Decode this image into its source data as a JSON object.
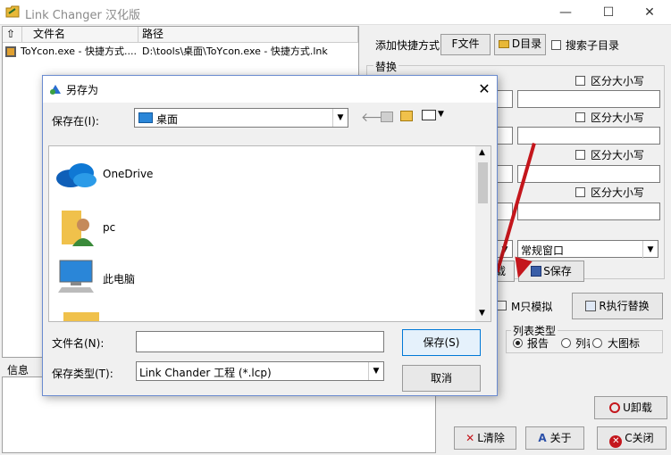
{
  "window": {
    "title": "Link Changer 汉化版",
    "min": "—",
    "max": "☐",
    "close": "✕"
  },
  "list": {
    "headers": [
      "⇧",
      "文件名",
      "路径"
    ],
    "rows": [
      {
        "name": "ToYcon.exe - 快捷方式....",
        "path": "D:\\tools\\桌面\\ToYcon.exe - 快捷方式.lnk"
      }
    ]
  },
  "right": {
    "add_label": "添加快捷方式",
    "file_btn": "F文件",
    "dir_btn": "D目录",
    "search_sub": "搜索子目录",
    "replace_label": "替换",
    "case": [
      "区分大小写",
      "区分大小写",
      "区分大小写",
      "区分大小写"
    ],
    "window_mode": "常规窗口",
    "load_btn": "载",
    "save_btn": "S保存",
    "simulate": "M只模拟",
    "execute_btn": "R执行替换",
    "list_type_label": "列表类型",
    "list_types": [
      "报告",
      "列表",
      "大图标"
    ],
    "uninstall_btn": "U卸载",
    "clear_btn": "L清除",
    "about_btn": "关于",
    "close_btn": "C关闭"
  },
  "info_label": "信息",
  "dialog": {
    "title": "另存为",
    "save_in_label": "保存在(I):",
    "save_in_value": "桌面",
    "places": [
      "OneDrive",
      "pc",
      "此电脑"
    ],
    "filename_label": "文件名(N):",
    "filename_value": "",
    "filetype_label": "保存类型(T):",
    "filetype_value": "Link Chander 工程 (*.lcp)",
    "save_btn": "保存(S)",
    "cancel_btn": "取消"
  },
  "colors": {
    "arrow": "#c4161c",
    "accent": "#0078d7",
    "folder": "#f0c14b"
  }
}
